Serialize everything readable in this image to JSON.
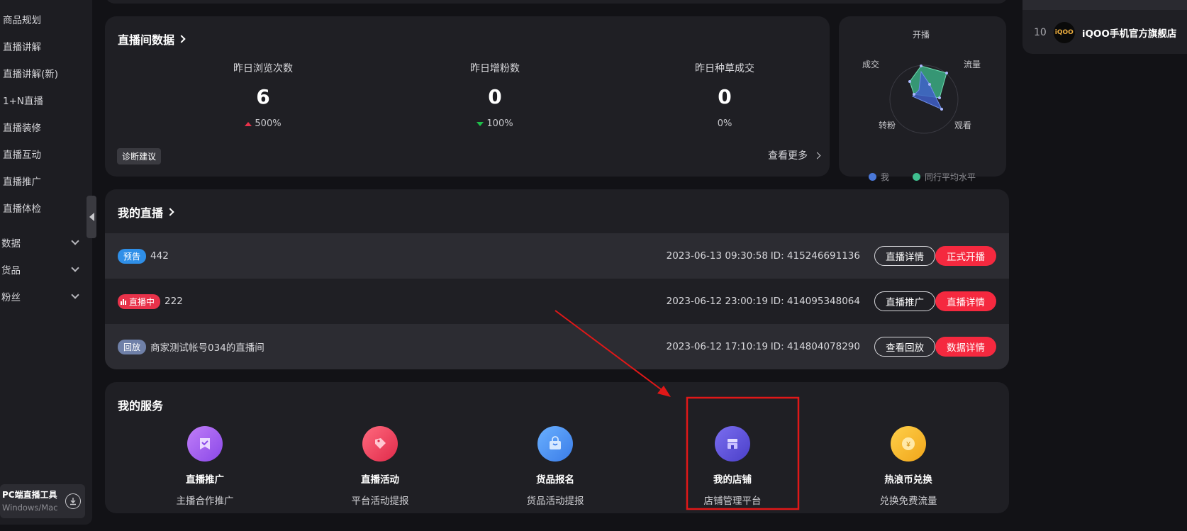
{
  "sidebar": {
    "items": [
      "商品规划",
      "直播讲解",
      "直播讲解(新)",
      "1+N直播",
      "直播装修",
      "直播互动",
      "直播推广",
      "直播体检"
    ],
    "groups": [
      "数据",
      "货品",
      "粉丝"
    ],
    "pc_tool": {
      "title": "PC端直播工具",
      "subtitle": "Windows/Mac"
    }
  },
  "live_data": {
    "title": "直播间数据",
    "stats": [
      {
        "label": "昨日浏览次数",
        "value": "6",
        "change": "500%",
        "trend": "up"
      },
      {
        "label": "昨日增粉数",
        "value": "0",
        "change": "100%",
        "trend": "down"
      },
      {
        "label": "昨日种草成交",
        "value": "0",
        "change": "0%",
        "trend": "none"
      }
    ],
    "diagnose_label": "诊断建议",
    "more_label": "查看更多"
  },
  "radar": {
    "axes": [
      "开播",
      "流量",
      "观看",
      "转粉",
      "成交"
    ],
    "legend": [
      {
        "name": "我",
        "color": "#4a78d8"
      },
      {
        "name": "同行平均水平",
        "color": "#3fbf8f"
      }
    ]
  },
  "my_live": {
    "title": "我的直播",
    "rows": [
      {
        "badge": "预告",
        "badge_color": "#2f8fe8",
        "name": "442",
        "time": "2023-06-13 09:30:58",
        "id": "ID: 415246691136",
        "btn1": "直播详情",
        "btn2": "正式开播"
      },
      {
        "badge": "直播中",
        "badge_color": "#e8324a",
        "name": "222",
        "time": "2023-06-12 23:00:19",
        "id": "ID: 414095348064",
        "btn1": "直播推广",
        "btn2": "直播详情"
      },
      {
        "badge": "回放",
        "badge_color": "#6f80a8",
        "name": "商家测试帐号034的直播间",
        "time": "2023-06-12 17:10:19",
        "id": "ID: 414804078290",
        "btn1": "查看回放",
        "btn2": "数据详情"
      }
    ]
  },
  "services": {
    "title": "我的服务",
    "items": [
      {
        "name": "直播推广",
        "desc": "主播合作推广",
        "icon": "promotion-icon",
        "color": "#a25cf0"
      },
      {
        "name": "直播活动",
        "desc": "平台活动提报",
        "icon": "tag-icon",
        "color": "#ee3f5e"
      },
      {
        "name": "货品报名",
        "desc": "货品活动提报",
        "icon": "shopping-bag-icon",
        "color": "#4a8ef0"
      },
      {
        "name": "我的店铺",
        "desc": "店铺管理平台",
        "icon": "store-icon",
        "color": "#5b4fd8"
      },
      {
        "name": "热浪币兑换",
        "desc": "兑换免费流量",
        "icon": "coin-icon",
        "color": "#f5b52a"
      }
    ]
  },
  "ranking": {
    "rank": "10",
    "logo_text": "iQOO",
    "name": "iQOO手机官方旗舰店"
  },
  "annotation": {
    "color": "#e01818"
  }
}
